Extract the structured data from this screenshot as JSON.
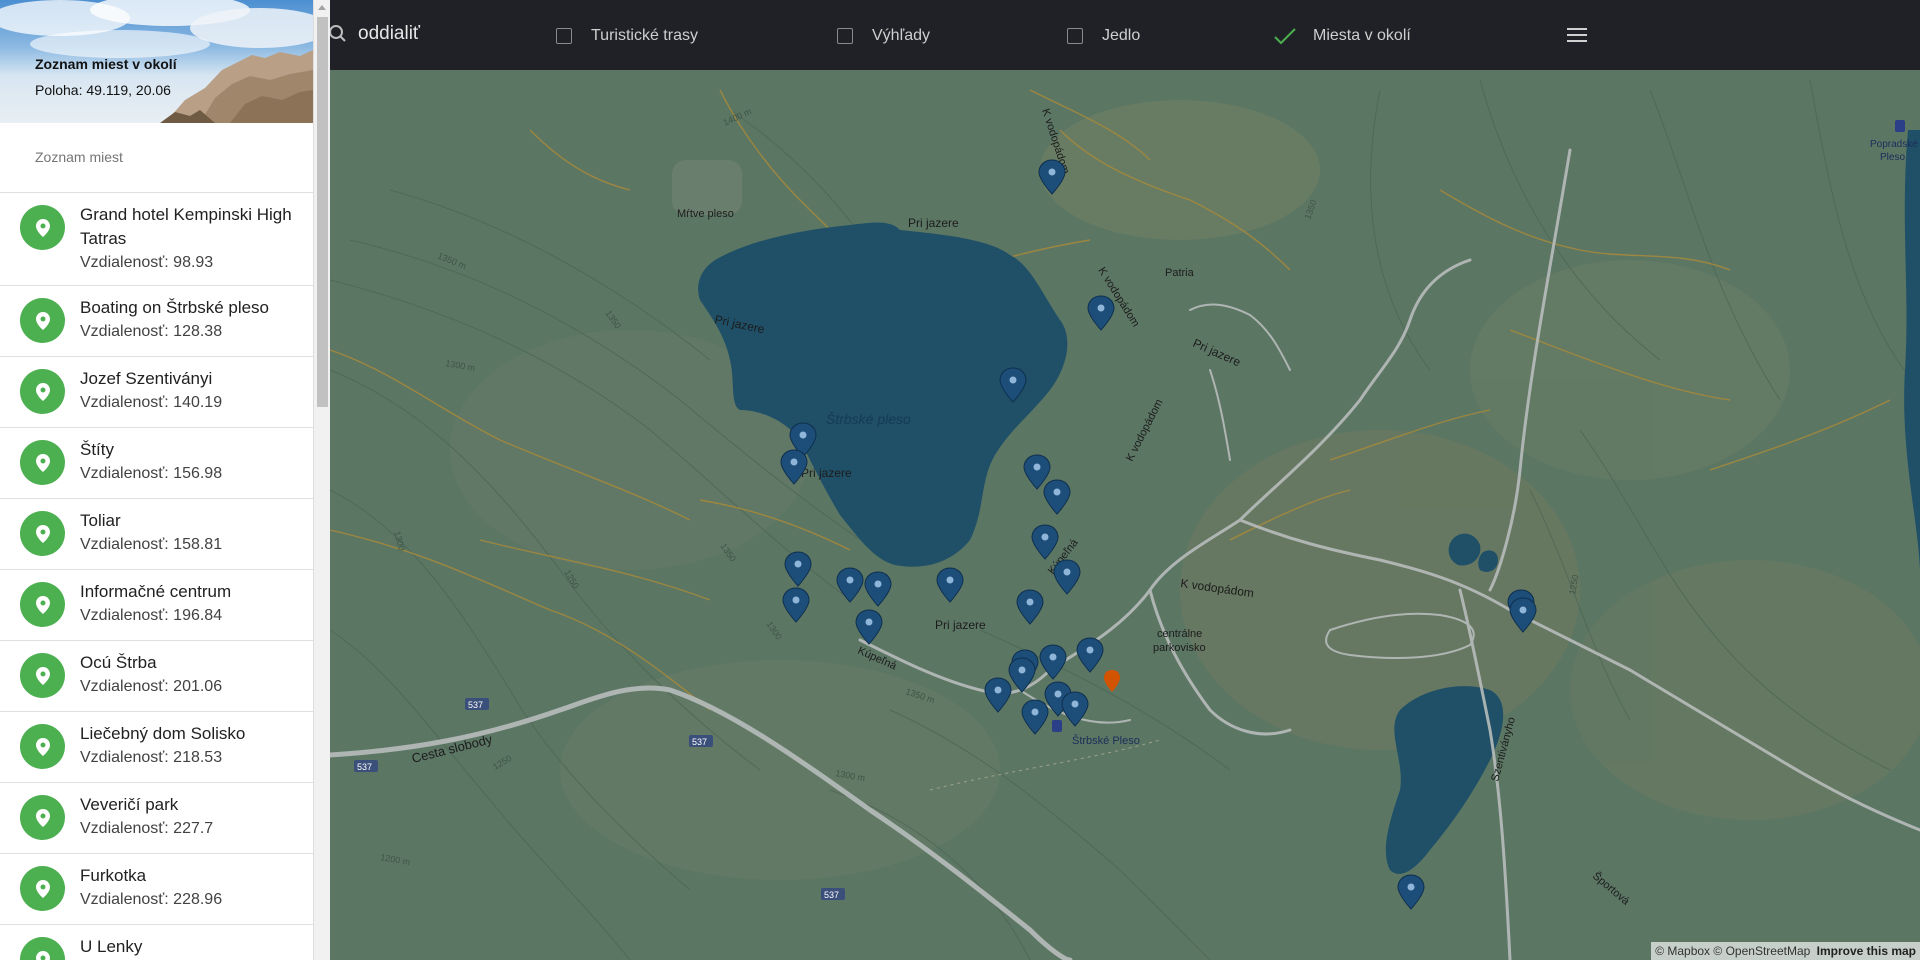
{
  "sidebar": {
    "title": "Zoznam miest v okolí",
    "position_text": "Poloha: 49.119, 20.06",
    "subheader": "Zoznam miest",
    "items": [
      {
        "name": "Grand hotel Kempinski High Tatras",
        "distance": "Vzdialenosť: 98.93"
      },
      {
        "name": "Boating on Štrbské pleso",
        "distance": "Vzdialenosť: 128.38"
      },
      {
        "name": "Jozef Szentiványi",
        "distance": "Vzdialenosť: 140.19"
      },
      {
        "name": "Štíty",
        "distance": "Vzdialenosť: 156.98"
      },
      {
        "name": "Toliar",
        "distance": "Vzdialenosť: 158.81"
      },
      {
        "name": "Informačné centrum",
        "distance": "Vzdialenosť: 196.84"
      },
      {
        "name": "Ocú Štrba",
        "distance": "Vzdialenosť: 201.06"
      },
      {
        "name": "Liečebný dom Solisko",
        "distance": "Vzdialenosť: 218.53"
      },
      {
        "name": "Veveričí park",
        "distance": "Vzdialenosť: 227.7"
      },
      {
        "name": "Furkotka",
        "distance": "Vzdialenosť: 228.96"
      },
      {
        "name": "U Lenky",
        "distance": ""
      }
    ]
  },
  "topbar": {
    "zoom_out_label": "oddialiť",
    "filters": [
      {
        "label": "Turistické trasy",
        "checked": false
      },
      {
        "label": "Výhľady",
        "checked": false
      },
      {
        "label": "Jedlo",
        "checked": false
      },
      {
        "label": "Miesta v okolí",
        "checked": true
      }
    ]
  },
  "map": {
    "labels": {
      "lake": "Štrbské pleso",
      "mrtve_pleso": "Mŕtve pleso",
      "patria": "Patria",
      "pri_jazere_1": "Pri jazere",
      "pri_jazere_2": "Pri jazere",
      "pri_jazere_3": "Pri jazere",
      "pri_jazere_4": "Pri jazere",
      "pri_jazere_5": "Pri jazere",
      "k_vodopadom_1": "K vodopádom",
      "k_vodopadom_2": "K vodopádom",
      "k_vodopadom_3": "K vodopádom",
      "k_vodopadom_4": "K vodopádom",
      "kupelna_1": "Kúpeľná",
      "kupelna_2": "Kúpeľná",
      "cesta_slobody": "Cesta slobody",
      "centralne": "centrálne",
      "parkovisko": "parkovisko",
      "strbske_pleso_station": "Štrbské Pleso",
      "popradske": "Popradské",
      "pleso": "Pleso",
      "szentivanyho": "Szentiványho",
      "sportova": "Športová",
      "road_537": "537",
      "c1400": "1400 m",
      "c1350a": "1350 m",
      "c1350b": "1350",
      "c1300a": "1300 m",
      "c1300b": "1300",
      "c1250": "1250",
      "c1200": "1200 m"
    },
    "attribution": {
      "mapbox": "© Mapbox",
      "osm": "© OpenStreetMap",
      "improve": "Improve this map"
    },
    "colors": {
      "land": "#5c7664",
      "water": "#1f5068",
      "road": "#b7bcbb",
      "trail": "#a88a3a",
      "marker": "#1d4e7a",
      "current_location": "#d35400",
      "avatar": "#4caf50"
    }
  }
}
